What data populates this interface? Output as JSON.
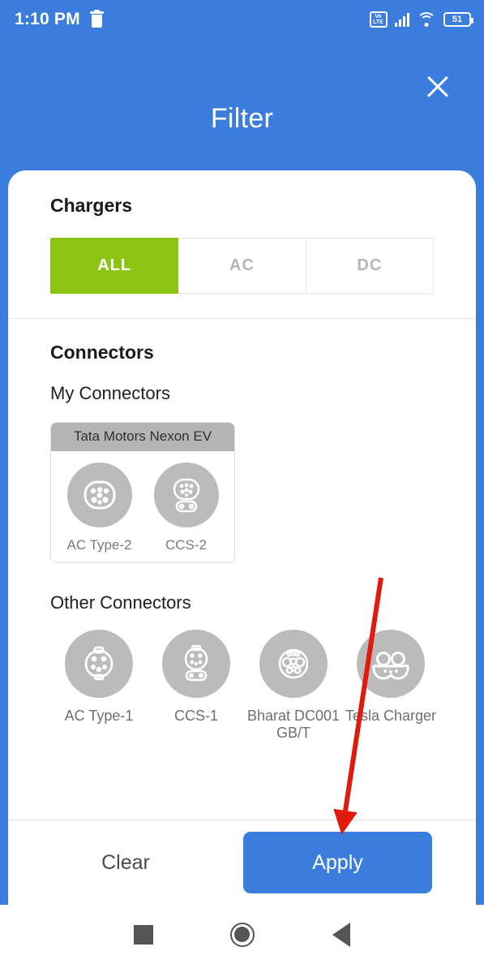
{
  "statusbar": {
    "time": "1:10 PM",
    "trash_icon": "trash-icon",
    "volte_top": "Vo",
    "volte_bottom": "LTE",
    "signal_icon": "signal-icon",
    "wifi_icon": "wifi-icon",
    "battery_level": "51"
  },
  "header": {
    "title": "Filter",
    "close_icon": "close-icon"
  },
  "chargers": {
    "title": "Chargers",
    "options": [
      {
        "label": "ALL",
        "selected": true
      },
      {
        "label": "AC",
        "selected": false
      },
      {
        "label": "DC",
        "selected": false
      }
    ],
    "accent_color": "#8cc414"
  },
  "connectors": {
    "title": "Connectors",
    "my_connectors_label": "My Connectors",
    "my_vehicle": "Tata Motors Nexon EV",
    "my_items": [
      {
        "label": "AC Type-2",
        "icon": "ac-type-2-connector-icon"
      },
      {
        "label": "CCS-2",
        "icon": "ccs-2-connector-icon"
      }
    ],
    "other_connectors_label": "Other Connectors",
    "other_items": [
      {
        "label": "AC Type-1",
        "icon": "ac-type-1-connector-icon"
      },
      {
        "label": "CCS-1",
        "icon": "ccs-1-connector-icon"
      },
      {
        "label": "Bharat DC001 GB/T",
        "icon": "bharat-dc001-gbt-connector-icon"
      },
      {
        "label": "Tesla Charger",
        "icon": "tesla-charger-connector-icon"
      }
    ]
  },
  "footer": {
    "clear_label": "Clear",
    "apply_label": "Apply",
    "apply_color": "#3b7ddc"
  },
  "navbar": {
    "recents_icon": "square-recents-icon",
    "home_icon": "circle-home-icon",
    "back_icon": "triangle-back-icon"
  },
  "annotation": {
    "arrow_color": "#e01b0c",
    "arrow_target": "Apply"
  }
}
